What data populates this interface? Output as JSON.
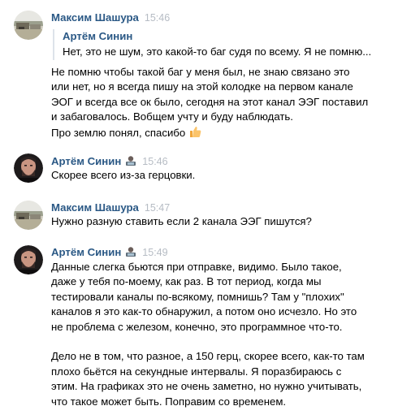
{
  "messages": [
    {
      "author": "Максим Шашура",
      "time": "15:46",
      "avatar": "landscape-photo-avatar",
      "quote": {
        "author": "Артём Синин",
        "text": "Нет, это не шум, это какой-то баг судя по всему. Я не помню..."
      },
      "lines": [
        "Не помню чтобы такой баг у меня был, не знаю связано это",
        "или нет, но я всегда пишу на этой колодке на первом канале",
        "ЭОГ и всегда все ок было, сегодня на этот канал ЭЭГ поставил",
        "и забаговалось. Вобщем учту и буду наблюдать.",
        "Про землю понял, спасибо"
      ],
      "trailing_emoji": "thumbs-up-icon"
    },
    {
      "author": "Артём Синин",
      "time": "15:46",
      "avatar": "portrait-photo-avatar",
      "author_emoji": "technologist-emoji-icon",
      "lines": [
        "Скорее всего из-за герцовки."
      ]
    },
    {
      "author": "Максим Шашура",
      "time": "15:47",
      "avatar": "landscape-photo-avatar",
      "lines": [
        "Нужно разную ставить если 2 канала ЭЭГ пишутся?"
      ]
    },
    {
      "author": "Артём Синин",
      "time": "15:49",
      "avatar": "portrait-photo-avatar",
      "author_emoji": "technologist-emoji-icon",
      "lines": [
        "Данные слегка бьются при отправке, видимо. Было такое,",
        "даже у тебя по-моему, как раз. В тот период, когда мы",
        "тестировали каналы по-всякому, помнишь? Там у \"плохих\"",
        "каналов я это как-то обнаружил, а потом оно исчезло. Но это",
        "не проблема с железом, конечно, это программное что-то.",
        "",
        "Дело не в том, что разное, а 150 герц, скорее всего, как-то там",
        "плохо бьётся на секундные интервалы. Я поразбираюсь с",
        "этим. На графиках это не очень заметно, но нужно учитывать,",
        "что такое может быть. Поправим со временем."
      ]
    }
  ],
  "colors": {
    "author": "#2a5885",
    "time": "#b6bcc4",
    "text": "#000000",
    "quote_border": "#dde3ea"
  }
}
